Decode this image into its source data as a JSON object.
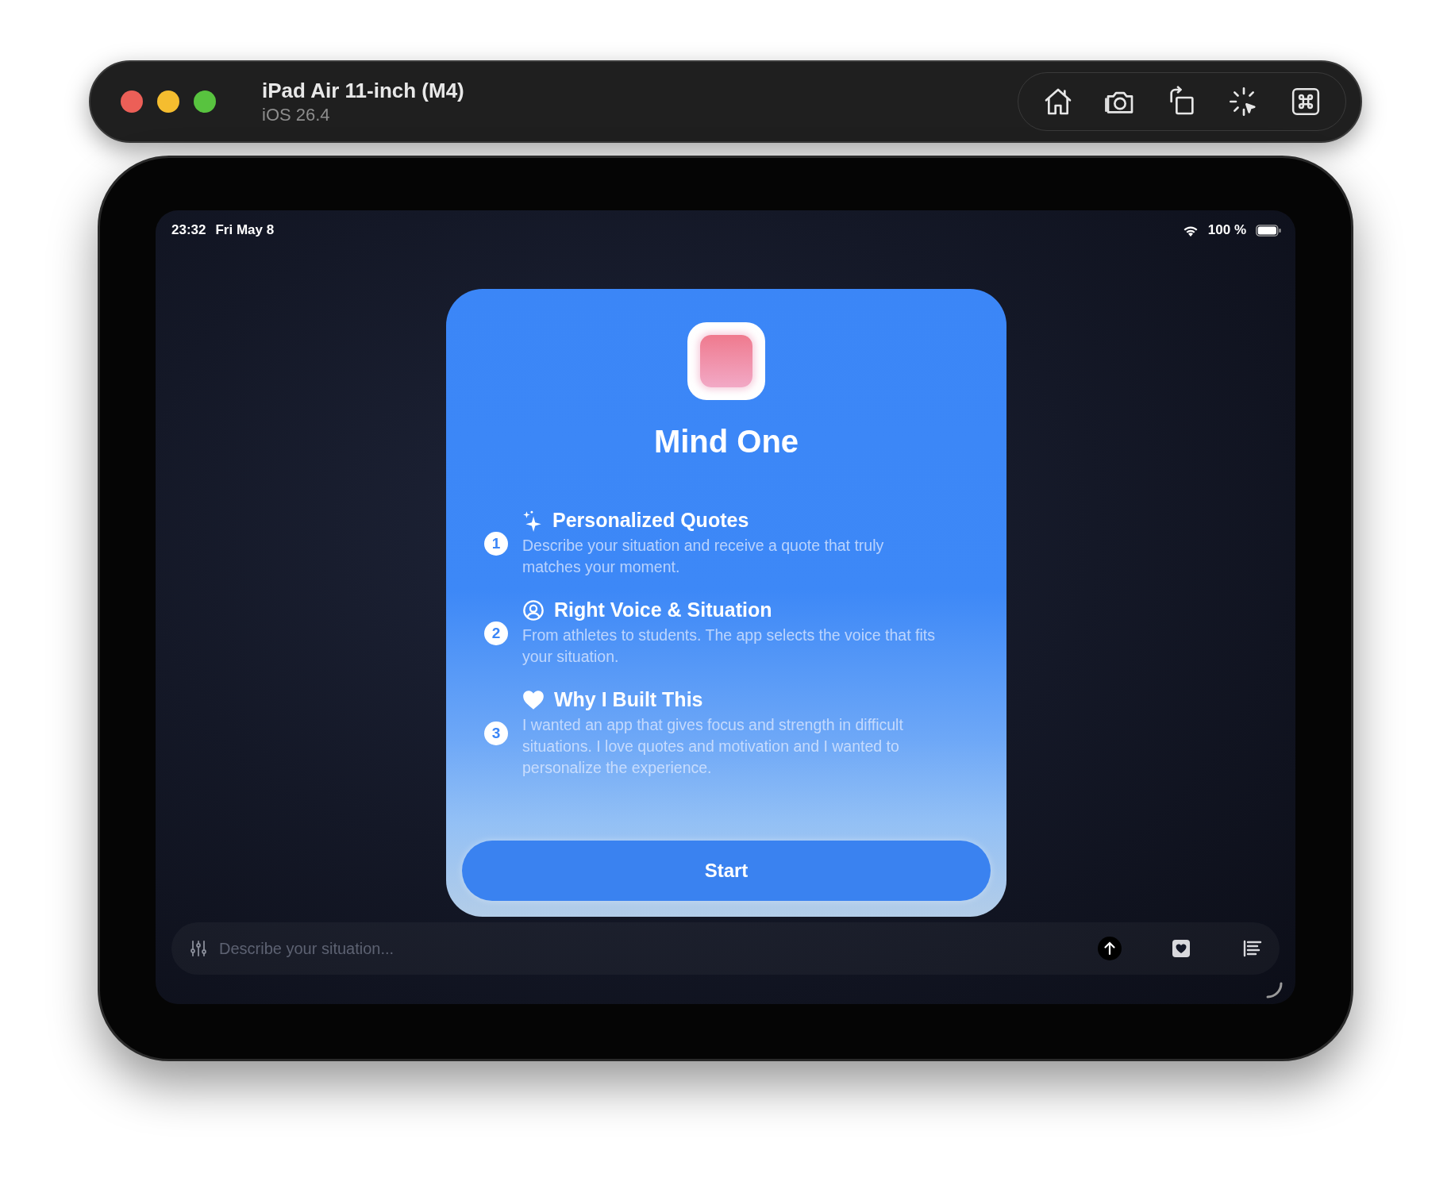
{
  "simulator": {
    "device": "iPad Air 11-inch (M4)",
    "os": "iOS 26.4"
  },
  "status_bar": {
    "time": "23:32",
    "date": "Fri May 8",
    "battery": "100 %"
  },
  "card": {
    "title": "Mind One",
    "features": [
      {
        "number": "1",
        "title": "Personalized Quotes",
        "description": "Describe your situation and receive a quote that truly matches your moment."
      },
      {
        "number": "2",
        "title": "Right Voice & Situation",
        "description": "From athletes to students. The app selects the voice that fits your situation."
      },
      {
        "number": "3",
        "title": "Why I Built This",
        "description": "I wanted an app that gives focus and strength in difficult situations. I love quotes and motivation and I wanted to personalize the experience."
      }
    ],
    "button": "Start"
  },
  "input": {
    "placeholder": "Describe your situation..."
  }
}
